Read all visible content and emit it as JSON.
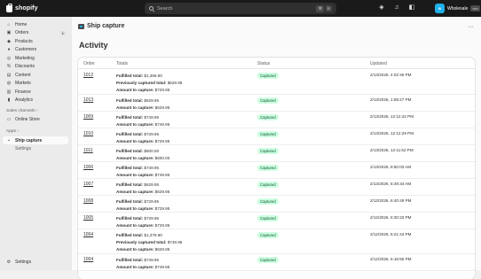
{
  "topbar": {
    "brand": "shopify",
    "search_placeholder": "Search",
    "kbd1": "⌘",
    "kbd2": "K",
    "store_initials": "Wholesale",
    "store_name": "Wholesale",
    "store_tag": "dev"
  },
  "sidebar": {
    "items": [
      {
        "label": "Home",
        "icon": "home-icon"
      },
      {
        "label": "Orders",
        "icon": "orders-icon",
        "badge": "1"
      },
      {
        "label": "Products",
        "icon": "products-icon"
      },
      {
        "label": "Customers",
        "icon": "customers-icon"
      },
      {
        "label": "Marketing",
        "icon": "marketing-icon"
      },
      {
        "label": "Discounts",
        "icon": "discounts-icon"
      },
      {
        "label": "Content",
        "icon": "content-icon"
      },
      {
        "label": "Markets",
        "icon": "markets-icon"
      },
      {
        "label": "Finance",
        "icon": "finance-icon"
      },
      {
        "label": "Analytics",
        "icon": "analytics-icon"
      }
    ],
    "sales_channels_label": "Sales channels",
    "online_store": "Online Store",
    "apps_label": "Apps",
    "ship_capture": "Ship capture",
    "settings_sub": "Settings",
    "settings": "Settings"
  },
  "main": {
    "app_title": "Ship capture",
    "more": "···",
    "page_title": "Activity",
    "columns": {
      "order": "Order",
      "totals": "Totals",
      "status": "Status",
      "updated": "Updated"
    },
    "rows": [
      {
        "order": "1012",
        "lines": [
          [
            "Fulfilled total:",
            "$1,359.60"
          ],
          [
            "Previously captured total:",
            "$629.95"
          ],
          [
            "Amount to capture:",
            "$729.95"
          ]
        ],
        "status": "Captured",
        "updated": "2/13/2026, 4:02:46 PM"
      },
      {
        "order": "1013",
        "lines": [
          [
            "Fulfilled total:",
            "$629.95"
          ],
          [
            "Amount to capture:",
            "$629.95"
          ]
        ],
        "status": "Captured",
        "updated": "2/13/2026, 1:59:27 PM"
      },
      {
        "order": "1009",
        "lines": [
          [
            "Fulfilled total:",
            "$749.95"
          ],
          [
            "Amount to capture:",
            "$749.95"
          ]
        ],
        "status": "Captured",
        "updated": "2/13/2026, 12:12:42 PM"
      },
      {
        "order": "1010",
        "lines": [
          [
            "Fulfilled total:",
            "$729.95"
          ],
          [
            "Amount to capture:",
            "$729.95"
          ]
        ],
        "status": "Captured",
        "updated": "2/13/2026, 12:12:29 PM"
      },
      {
        "order": "1011",
        "lines": [
          [
            "Fulfilled total:",
            "$600.00"
          ],
          [
            "Amount to capture:",
            "$600.00"
          ]
        ],
        "status": "Captured",
        "updated": "2/13/2026, 12:11:52 PM"
      },
      {
        "order": "1006",
        "lines": [
          [
            "Fulfilled total:",
            "$749.95"
          ],
          [
            "Amount to capture:",
            "$749.95"
          ]
        ],
        "status": "Captured",
        "updated": "2/13/2026, 8:50:03 AM"
      },
      {
        "order": "1007",
        "lines": [
          [
            "Fulfilled total:",
            "$629.95"
          ],
          [
            "Amount to capture:",
            "$629.95"
          ]
        ],
        "status": "Captured",
        "updated": "2/13/2026, 8:49:34 AM"
      },
      {
        "order": "1008",
        "lines": [
          [
            "Fulfilled total:",
            "$729.95"
          ],
          [
            "Amount to capture:",
            "$729.95"
          ]
        ],
        "status": "Captured",
        "updated": "2/12/2026, 6:40:49 PM"
      },
      {
        "order": "1005",
        "lines": [
          [
            "Fulfilled total:",
            "$729.95"
          ],
          [
            "Amount to capture:",
            "$729.95"
          ]
        ],
        "status": "Captured",
        "updated": "2/12/2026, 6:30:23 PM"
      },
      {
        "order": "1004",
        "lines": [
          [
            "Fulfilled total:",
            "$1,379.90"
          ],
          [
            "Previously captured total:",
            "$749.95"
          ],
          [
            "Amount to capture:",
            "$629.95"
          ]
        ],
        "status": "Captured",
        "updated": "2/12/2026, 5:21:44 PM"
      },
      {
        "order": "1004",
        "lines": [
          [
            "Fulfilled total:",
            "$749.95"
          ],
          [
            "Amount to capture:",
            "$749.95"
          ]
        ],
        "status": "Captured",
        "updated": "2/12/2026, 5:16:55 PM"
      }
    ]
  },
  "colors": {
    "topbar": "#1a1a1a",
    "status_bg": "#cdfee1",
    "status_fg": "#0c5132",
    "store_avatar": "#1fb1ea"
  }
}
